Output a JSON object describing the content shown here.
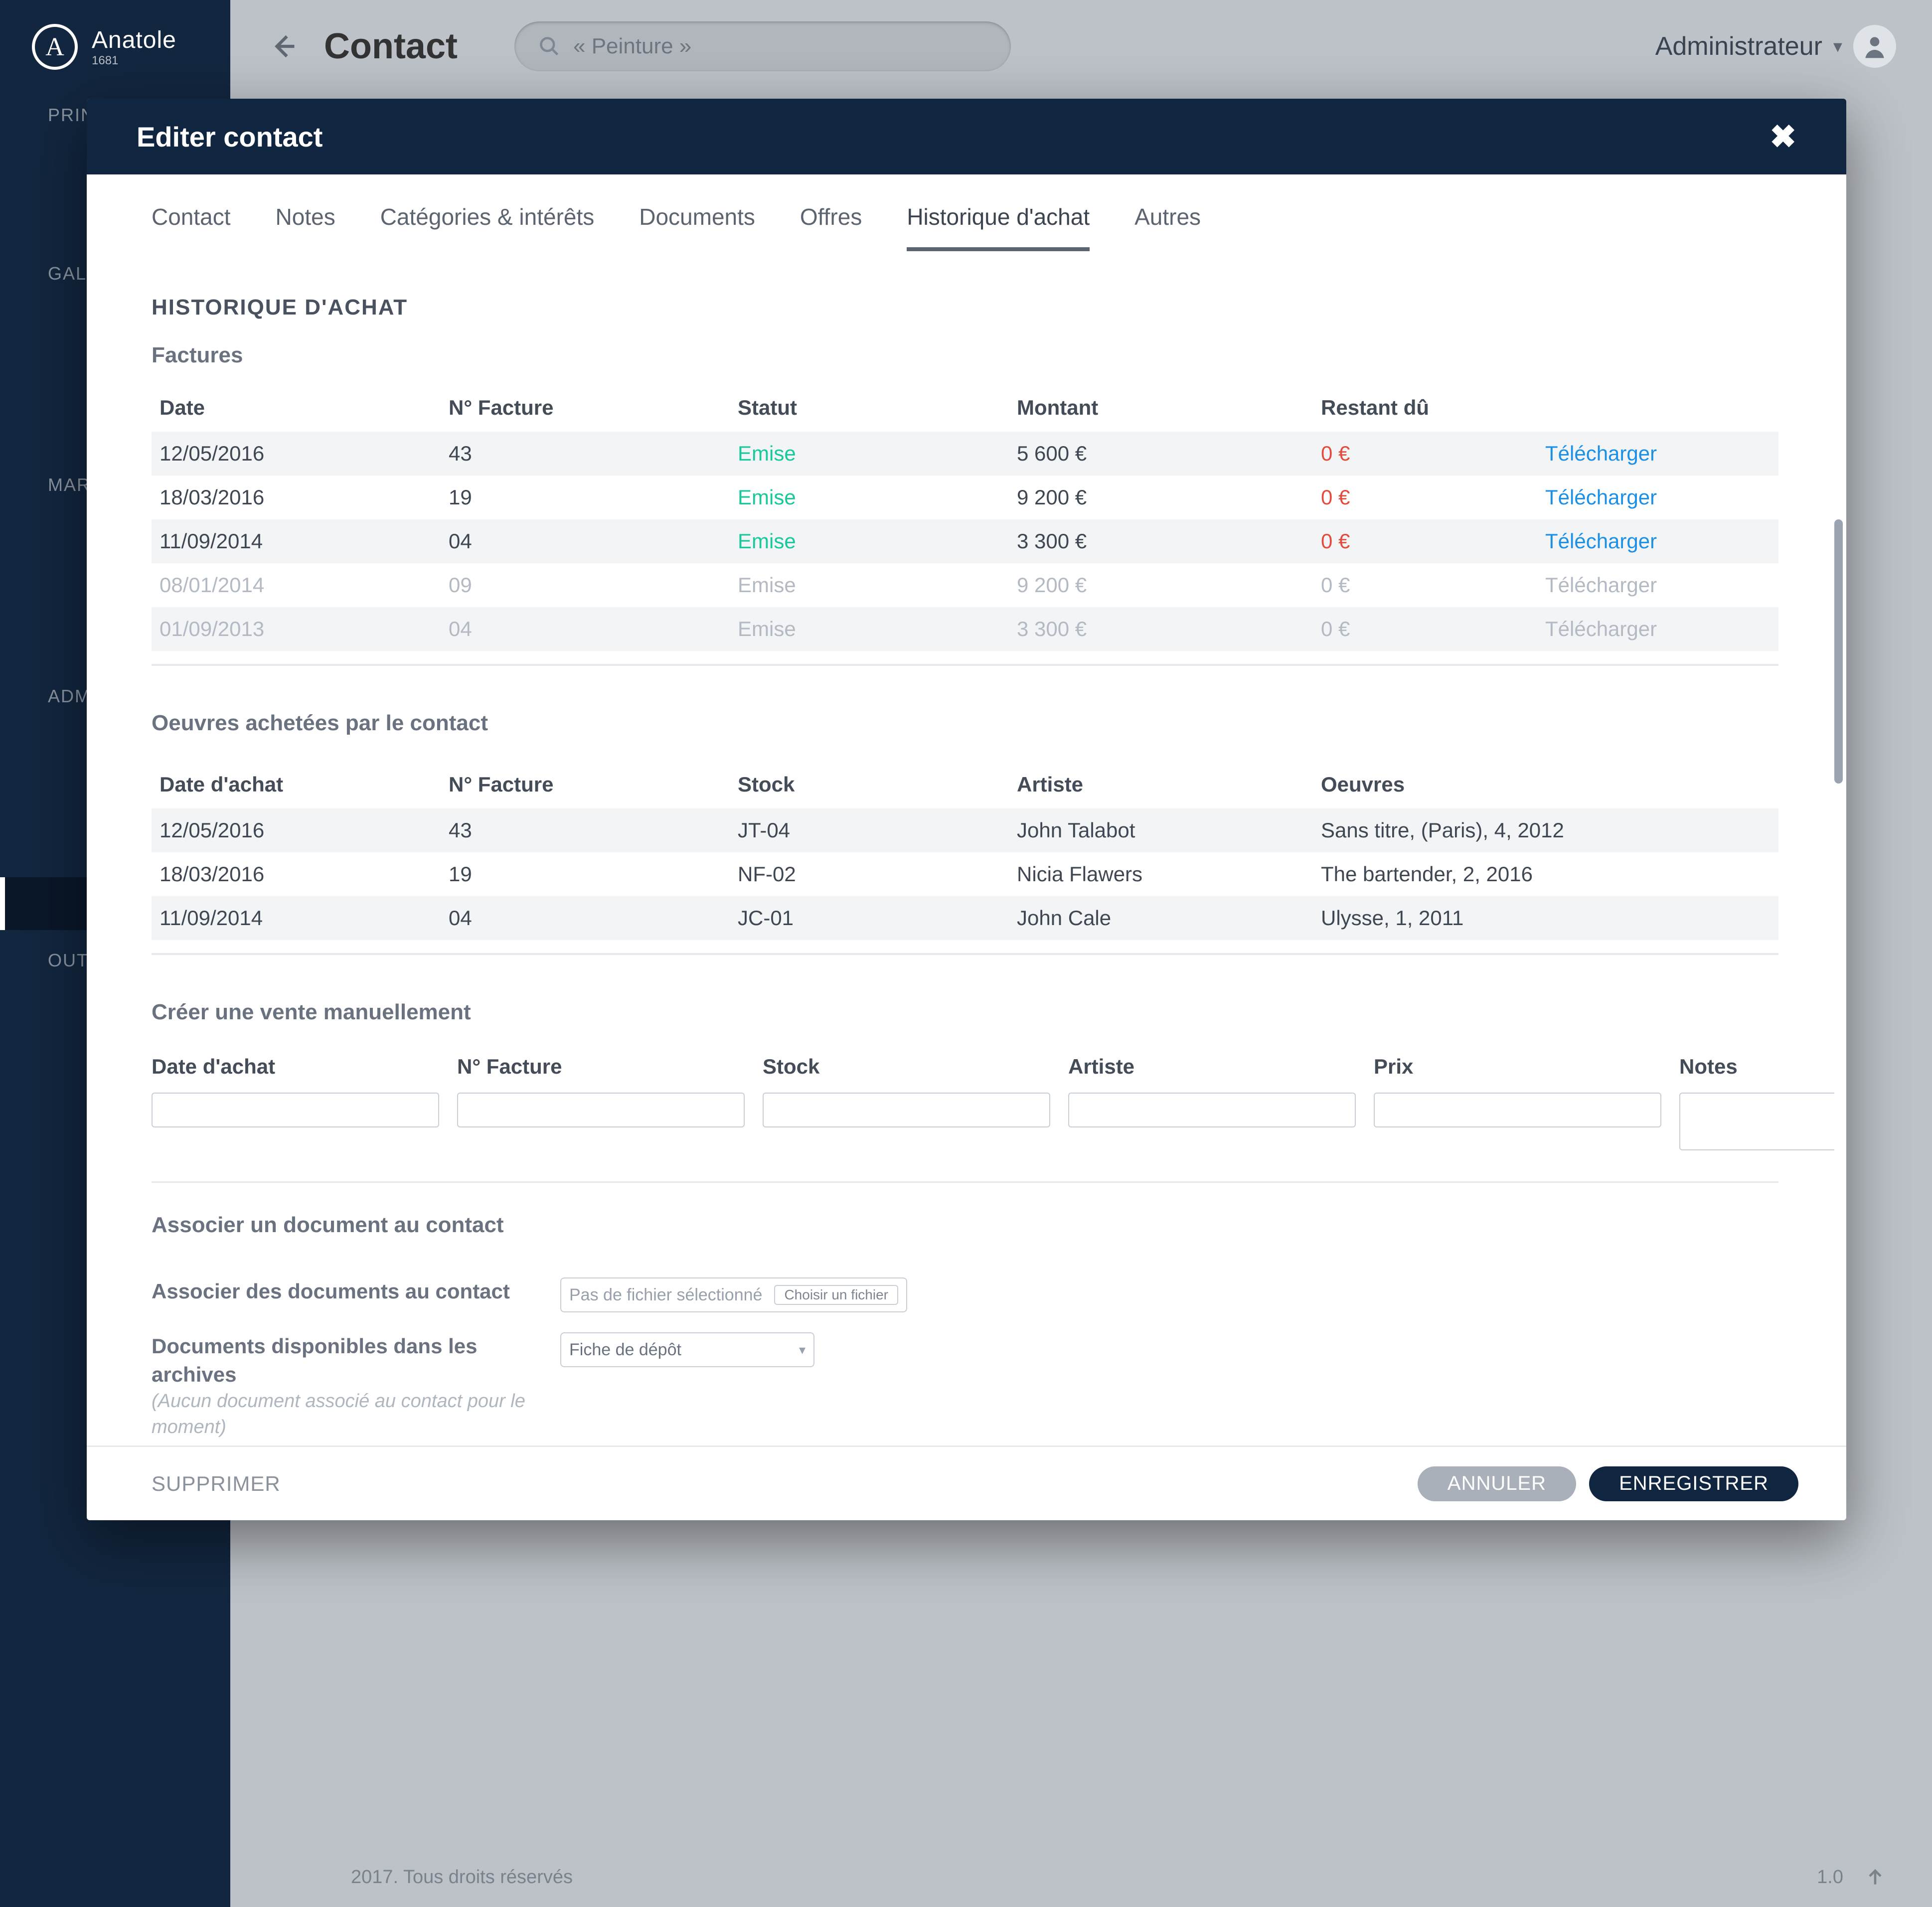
{
  "app": {
    "brand_name": "Anatole",
    "brand_sub": "1681",
    "page_title": "Contact",
    "search_placeholder": "« Peinture »",
    "user_label": "Administrateur",
    "footer_copyright": "2017. Tous droits réservés",
    "version": "1.0"
  },
  "sidebar": {
    "sections": [
      {
        "label": "PRINC",
        "icons": [
          "eye-icon",
          "home-icon"
        ]
      },
      {
        "label": "GALER",
        "icons": [
          "image-icon",
          "monitor-icon",
          "archive-icon"
        ]
      },
      {
        "label": "MARK",
        "icons": [
          "mail-icon",
          "cart-icon",
          "chart-icon"
        ]
      },
      {
        "label": "ADMI",
        "icons": [
          "card-icon",
          "doc-icon",
          "book-icon",
          "tablet-icon"
        ]
      },
      {
        "label": "OUTIL",
        "icons": [
          "gear-icon"
        ]
      }
    ],
    "bottom_icons": [
      "help-icon",
      "file-icon"
    ],
    "active_icon_index": [
      3,
      3
    ]
  },
  "modal": {
    "title": "Editer contact",
    "tabs": [
      "Contact",
      "Notes",
      "Catégories & intérêts",
      "Documents",
      "Offres",
      "Historique d'achat",
      "Autres"
    ],
    "active_tab": 5,
    "history": {
      "heading": "HISTORIQUE D'ACHAT",
      "invoices": {
        "title": "Factures",
        "columns": [
          "Date",
          "N° Facture",
          "Statut",
          "Montant",
          "Restant dû",
          ""
        ],
        "rows": [
          {
            "date": "12/05/2016",
            "nf": "43",
            "status": "Emise",
            "amount": "5 600 €",
            "due": "0 €",
            "link": "Télécharger",
            "dim": false
          },
          {
            "date": "18/03/2016",
            "nf": "19",
            "status": "Emise",
            "amount": "9 200 €",
            "due": "0 €",
            "link": "Télécharger",
            "dim": false
          },
          {
            "date": "11/09/2014",
            "nf": "04",
            "status": "Emise",
            "amount": "3 300 €",
            "due": "0 €",
            "link": "Télécharger",
            "dim": false
          },
          {
            "date": "08/01/2014",
            "nf": "09",
            "status": "Emise",
            "amount": "9 200 €",
            "due": "0 €",
            "link": "Télécharger",
            "dim": true
          },
          {
            "date": "01/09/2013",
            "nf": "04",
            "status": "Emise",
            "amount": "3 300 €",
            "due": "0 €",
            "link": "Télécharger",
            "dim": true
          }
        ]
      },
      "works": {
        "title": "Oeuvres achetées par le contact",
        "columns": [
          "Date d'achat",
          "N° Facture",
          "Stock",
          "Artiste",
          "Oeuvres"
        ],
        "rows": [
          {
            "date": "12/05/2016",
            "nf": "43",
            "stock": "JT-04",
            "artist": "John Talabot",
            "work": "Sans titre, (Paris), 4, 2012"
          },
          {
            "date": "18/03/2016",
            "nf": "19",
            "stock": "NF-02",
            "artist": "Nicia Flawers",
            "work": "The bartender, 2, 2016"
          },
          {
            "date": "11/09/2014",
            "nf": "04",
            "stock": "JC-01",
            "artist": "John Cale",
            "work": "Ulysse, 1, 2011"
          }
        ]
      },
      "manual_sale": {
        "title": "Créer une vente manuellement",
        "labels": {
          "date": "Date d'achat",
          "nf": "N° Facture",
          "stock": "Stock",
          "artist": "Artiste",
          "price": "Prix",
          "notes": "Notes"
        },
        "values": {
          "date": "",
          "nf": "",
          "stock": "",
          "artist": "",
          "price": "",
          "notes": ""
        }
      },
      "associate": {
        "title": "Associer un document au contact",
        "row1_label": "Associer des documents au contact",
        "file_text": "Pas de fichier sélectionné",
        "file_button": "Choisir un fichier",
        "row2_label": "Documents disponibles dans les archives",
        "row2_note": "(Aucun document associé au contact pour le moment)",
        "select_value": "Fiche de dépôt"
      }
    },
    "footer": {
      "delete": "SUPPRIMER",
      "cancel": "ANNULER",
      "save": "ENREGISTRER"
    }
  }
}
